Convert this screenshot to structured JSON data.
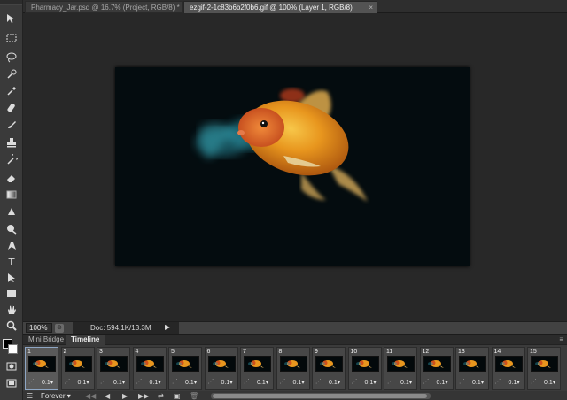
{
  "tabs": [
    {
      "label": "Pharmacy_Jar.psd @ 16.7% (Project, RGB/8) *",
      "active": false
    },
    {
      "label": "ezgif-2-1c83b6b2f0b6.gif @ 100% (Layer 1, RGB/8)",
      "active": true
    }
  ],
  "tab_close_glyph": "×",
  "tools": [
    "move-icon",
    "marquee-icon",
    "lasso-icon",
    "quick-select-icon",
    "eyedropper-icon",
    "healing-brush-icon",
    "brush-icon",
    "clone-stamp-icon",
    "history-brush-icon",
    "eraser-icon",
    "gradient-icon",
    "blur-icon",
    "dodge-icon",
    "pen-icon",
    "type-icon",
    "path-select-icon",
    "rectangle-icon",
    "hand-icon",
    "zoom-icon"
  ],
  "tool_glyphs": {
    "type": "T"
  },
  "status": {
    "zoom": "100%",
    "doc": "Doc: 594.1K/13.3M",
    "arrow": "▶"
  },
  "panel": {
    "tabs": [
      {
        "label": "Mini Bridge",
        "active": false
      },
      {
        "label": "Timeline",
        "active": true
      }
    ],
    "menu_glyph": "≡"
  },
  "frames": [
    {
      "num": "1",
      "delay": "0.1▾"
    },
    {
      "num": "2",
      "delay": "0.1▾"
    },
    {
      "num": "3",
      "delay": "0.1▾"
    },
    {
      "num": "4",
      "delay": "0.1▾"
    },
    {
      "num": "5",
      "delay": "0.1▾"
    },
    {
      "num": "6",
      "delay": "0.1▾"
    },
    {
      "num": "7",
      "delay": "0.1▾"
    },
    {
      "num": "8",
      "delay": "0.1▾"
    },
    {
      "num": "9",
      "delay": "0.1▾"
    },
    {
      "num": "10",
      "delay": "0.1▾"
    },
    {
      "num": "11",
      "delay": "0.1▾"
    },
    {
      "num": "12",
      "delay": "0.1▾"
    },
    {
      "num": "13",
      "delay": "0.1▾"
    },
    {
      "num": "14",
      "delay": "0.1▾"
    },
    {
      "num": "15",
      "delay": "0.1▾"
    }
  ],
  "controls": {
    "loop": "Forever",
    "loop_arrow": "▾",
    "first": "◀◀",
    "prev": "◀",
    "play": "▶",
    "next": "▶▶",
    "tween": "⇄",
    "new_frame": "▣",
    "delete": "🗑"
  },
  "colors": {
    "accent_select": "#8ea6c4",
    "canvas_bg": "#040c0f",
    "fish_orange": "#e8961e",
    "fish_shadow": "#2fa3b6"
  }
}
